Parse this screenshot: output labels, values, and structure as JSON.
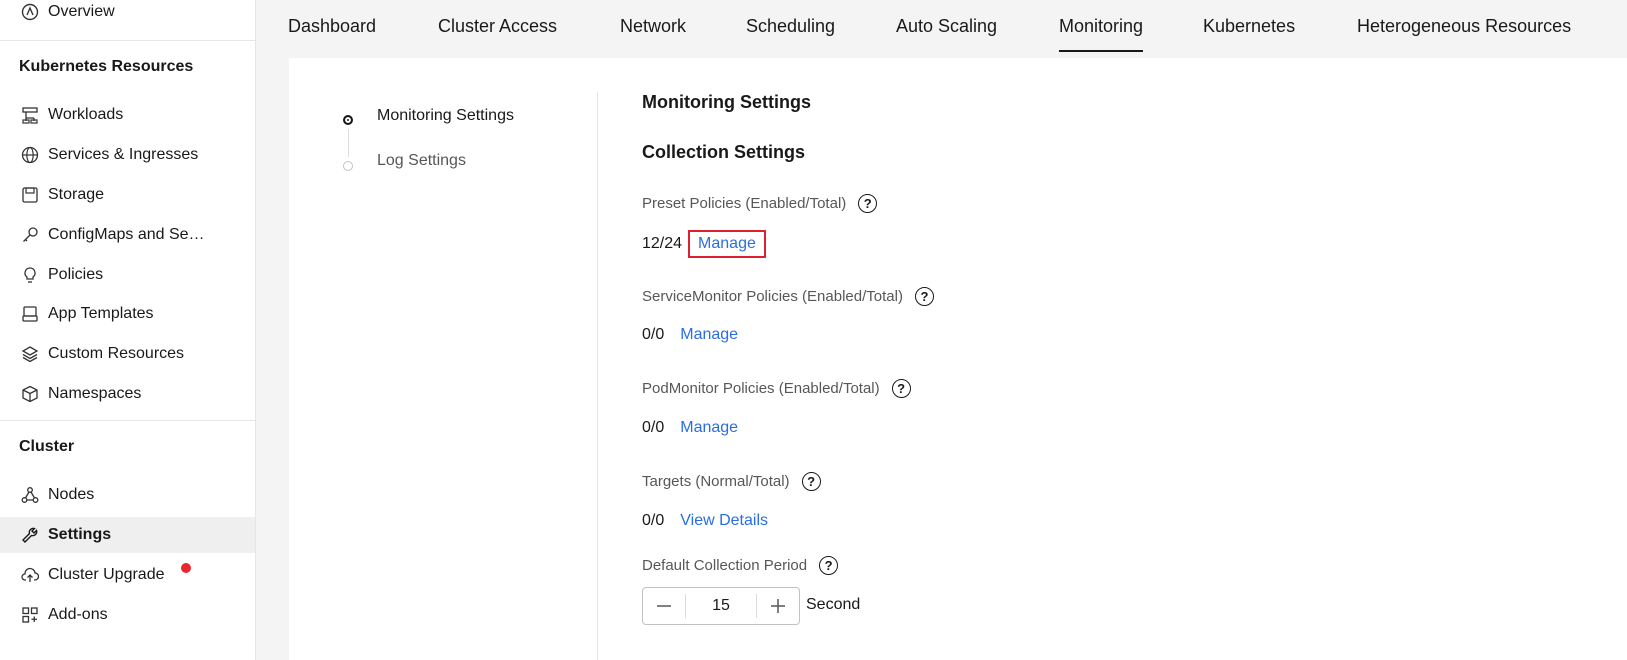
{
  "sidebar": {
    "overview": {
      "label": "Overview",
      "icon": "overview-icon"
    },
    "section_k8s": "Kubernetes Resources",
    "k8s_items": [
      {
        "label": "Workloads",
        "icon": "workloads-icon"
      },
      {
        "label": "Services & Ingresses",
        "icon": "globe-icon"
      },
      {
        "label": "Storage",
        "icon": "storage-icon"
      },
      {
        "label": "ConfigMaps and Se…",
        "icon": "key-icon"
      },
      {
        "label": "Policies",
        "icon": "lightbulb-icon"
      },
      {
        "label": "App Templates",
        "icon": "template-icon"
      },
      {
        "label": "Custom Resources",
        "icon": "layers-icon"
      },
      {
        "label": "Namespaces",
        "icon": "cube-icon"
      }
    ],
    "section_cluster": "Cluster",
    "cluster_items": [
      {
        "label": "Nodes",
        "icon": "nodes-icon"
      },
      {
        "label": "Settings",
        "icon": "wrench-icon",
        "active": true
      },
      {
        "label": "Cluster Upgrade",
        "icon": "upload-cloud-icon",
        "badge": "red-dot"
      },
      {
        "label": "Add-ons",
        "icon": "addons-icon"
      }
    ]
  },
  "tabs": [
    "Dashboard",
    "Cluster Access",
    "Network",
    "Scheduling",
    "Auto Scaling",
    "Monitoring",
    "Kubernetes",
    "Heterogeneous Resources"
  ],
  "active_tab": "Monitoring",
  "anchors": [
    "Monitoring Settings",
    "Log Settings"
  ],
  "main": {
    "title": "Monitoring Settings",
    "subtitle": "Collection Settings",
    "preset": {
      "label": "Preset Policies (Enabled/Total)",
      "value": "12/24",
      "action": "Manage"
    },
    "servicemonitor": {
      "label": "ServiceMonitor Policies (Enabled/Total)",
      "value": "0/0",
      "action": "Manage"
    },
    "podmonitor": {
      "label": "PodMonitor Policies (Enabled/Total)",
      "value": "0/0",
      "action": "Manage"
    },
    "targets": {
      "label": "Targets (Normal/Total)",
      "value": "0/0",
      "action": "View Details"
    },
    "period": {
      "label": "Default Collection Period",
      "value": "15",
      "unit": "Second"
    }
  },
  "help_glyph": "?",
  "colors": {
    "link": "#2a6ee3",
    "highlight": "#e0202e",
    "badge": "#e9262e"
  }
}
